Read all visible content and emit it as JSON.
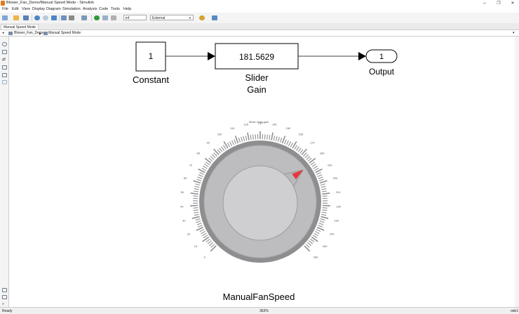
{
  "window": {
    "title": "Blower_Fan_Demo/Manual Speed Mode - Simulink",
    "min_glyph": "–",
    "max_glyph": "❐",
    "close_glyph": "✕"
  },
  "menu": [
    "File",
    "Edit",
    "View",
    "Display",
    "Diagram",
    "Simulation",
    "Analysis",
    "Code",
    "Tools",
    "Help"
  ],
  "toolbar": {
    "stop_time": "inf",
    "sim_mode": "External",
    "icons": [
      "new-model-icon",
      "open-icon",
      "save-icon",
      "back-icon",
      "forward-icon",
      "up-icon",
      "library-browser-icon",
      "model-settings-icon",
      "model-explorer-icon",
      "run-icon",
      "step-icon",
      "stop-icon",
      "build-icon",
      "scope-icon"
    ]
  },
  "tab": {
    "label": "Manual Speed Mode"
  },
  "breadcrumb": {
    "root": "Blower_Fan_Demo",
    "separator": "▶",
    "current": "Manual Speed Mode"
  },
  "palette_icons": [
    "zoom-icon",
    "fit-view-icon",
    "arrow-icon",
    "annotation-icon",
    "image-icon",
    "area-icon"
  ],
  "bottom_palette_icons": [
    "model-browser-icon",
    "properties-icon",
    "toggle-icon"
  ],
  "blocks": {
    "constant": {
      "value": "1",
      "label": "Constant"
    },
    "gain": {
      "value": "181.5629",
      "label_line1": "Slider",
      "label_line2": "Gain"
    },
    "outport": {
      "value": "1",
      "label": "Output"
    }
  },
  "knob": {
    "label": "ManualFanSpeed",
    "caption": "Slider Gain:gain",
    "scale_min": 0,
    "scale_max": 260,
    "value": 181.5629,
    "tick_labels": [
      "0",
      "10",
      "20",
      "30",
      "40",
      "50",
      "60",
      "70",
      "80",
      "90",
      "100",
      "110",
      "120",
      "130",
      "140",
      "150",
      "160",
      "170",
      "180",
      "190",
      "200",
      "210",
      "220",
      "230",
      "240",
      "250",
      "260"
    ],
    "colors": {
      "ring": "#8e8e90",
      "bezel": "#bdbdbf",
      "cap": "#d2d2d4",
      "needle": "#e8343f"
    }
  },
  "status": {
    "left": "Ready",
    "zoom": "363%",
    "solver": "ode1"
  }
}
